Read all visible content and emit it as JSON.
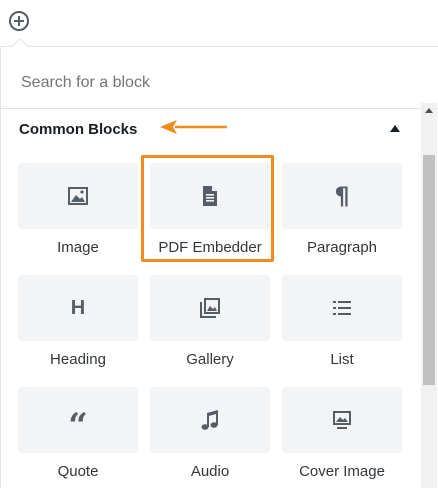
{
  "search": {
    "placeholder": "Search for a block"
  },
  "panel": {
    "title": "Common Blocks"
  },
  "blocks": [
    {
      "label": "Image",
      "icon": "image-icon"
    },
    {
      "label": "PDF Embedder",
      "icon": "document-icon"
    },
    {
      "label": "Paragraph",
      "icon": "paragraph-icon"
    },
    {
      "label": "Heading",
      "icon": "heading-icon"
    },
    {
      "label": "Gallery",
      "icon": "gallery-icon"
    },
    {
      "label": "List",
      "icon": "list-icon"
    },
    {
      "label": "Quote",
      "icon": "quote-icon"
    },
    {
      "label": "Audio",
      "icon": "audio-icon"
    },
    {
      "label": "Cover Image",
      "icon": "cover-image-icon"
    }
  ],
  "colors": {
    "highlight": "#f08c1c",
    "tile_bg": "#f3f4f5",
    "icon": "#555d66"
  }
}
